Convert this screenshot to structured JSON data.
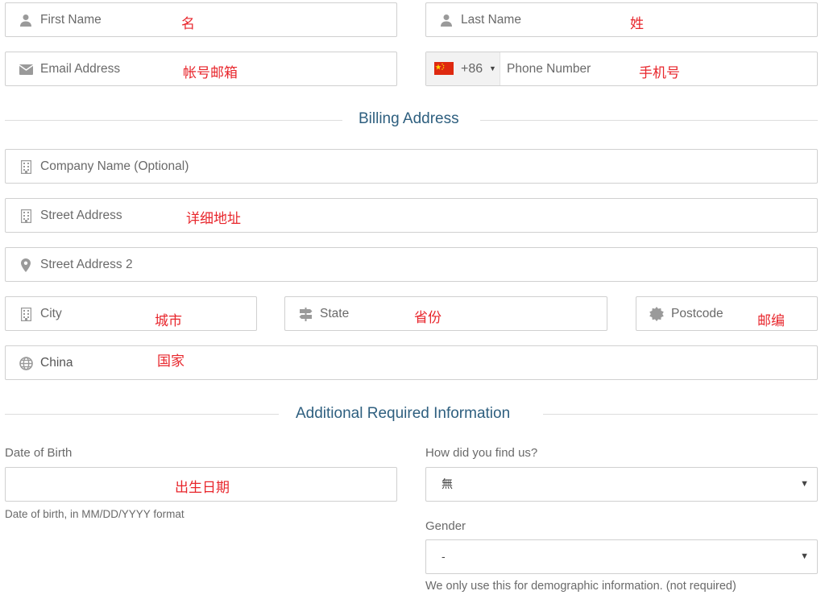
{
  "colors": {
    "annotation": "#e8262c",
    "section_title": "#2e5f7f",
    "border": "#d0d0d0",
    "icon": "#9a9a9a"
  },
  "name_row": {
    "first_name": {
      "placeholder": "First Name",
      "annotation": "名",
      "icon": "user-icon"
    },
    "last_name": {
      "placeholder": "Last Name",
      "annotation": "姓",
      "icon": "user-icon"
    }
  },
  "contact_row": {
    "email": {
      "placeholder": "Email Address",
      "annotation": "帐号邮箱",
      "icon": "envelope-icon"
    },
    "phone": {
      "country_code": "+86",
      "placeholder": "Phone Number",
      "annotation": "手机号",
      "flag": "china-flag-icon"
    }
  },
  "billing": {
    "title": "Billing Address",
    "company": {
      "placeholder": "Company Name (Optional)",
      "icon": "building-icon"
    },
    "street": {
      "placeholder": "Street Address",
      "annotation": "详细地址",
      "icon": "building-icon"
    },
    "street2": {
      "placeholder": "Street Address 2",
      "icon": "map-marker-icon"
    },
    "city": {
      "placeholder": "City",
      "annotation": "城市",
      "icon": "building-icon"
    },
    "state": {
      "placeholder": "State",
      "annotation": "省份",
      "icon": "signpost-icon"
    },
    "postcode": {
      "placeholder": "Postcode",
      "annotation": "邮编",
      "icon": "certificate-icon"
    },
    "country": {
      "value": "China",
      "annotation": "国家",
      "icon": "globe-icon"
    }
  },
  "additional": {
    "title": "Additional Required Information",
    "dob": {
      "label": "Date of Birth",
      "annotation": "出生日期",
      "help": "Date of birth, in MM/DD/YYYY format"
    },
    "find_us": {
      "label": "How did you find us?",
      "selected": "無"
    },
    "gender": {
      "label": "Gender",
      "selected": "-",
      "help": "We only use this for demographic information. (not required)"
    }
  }
}
